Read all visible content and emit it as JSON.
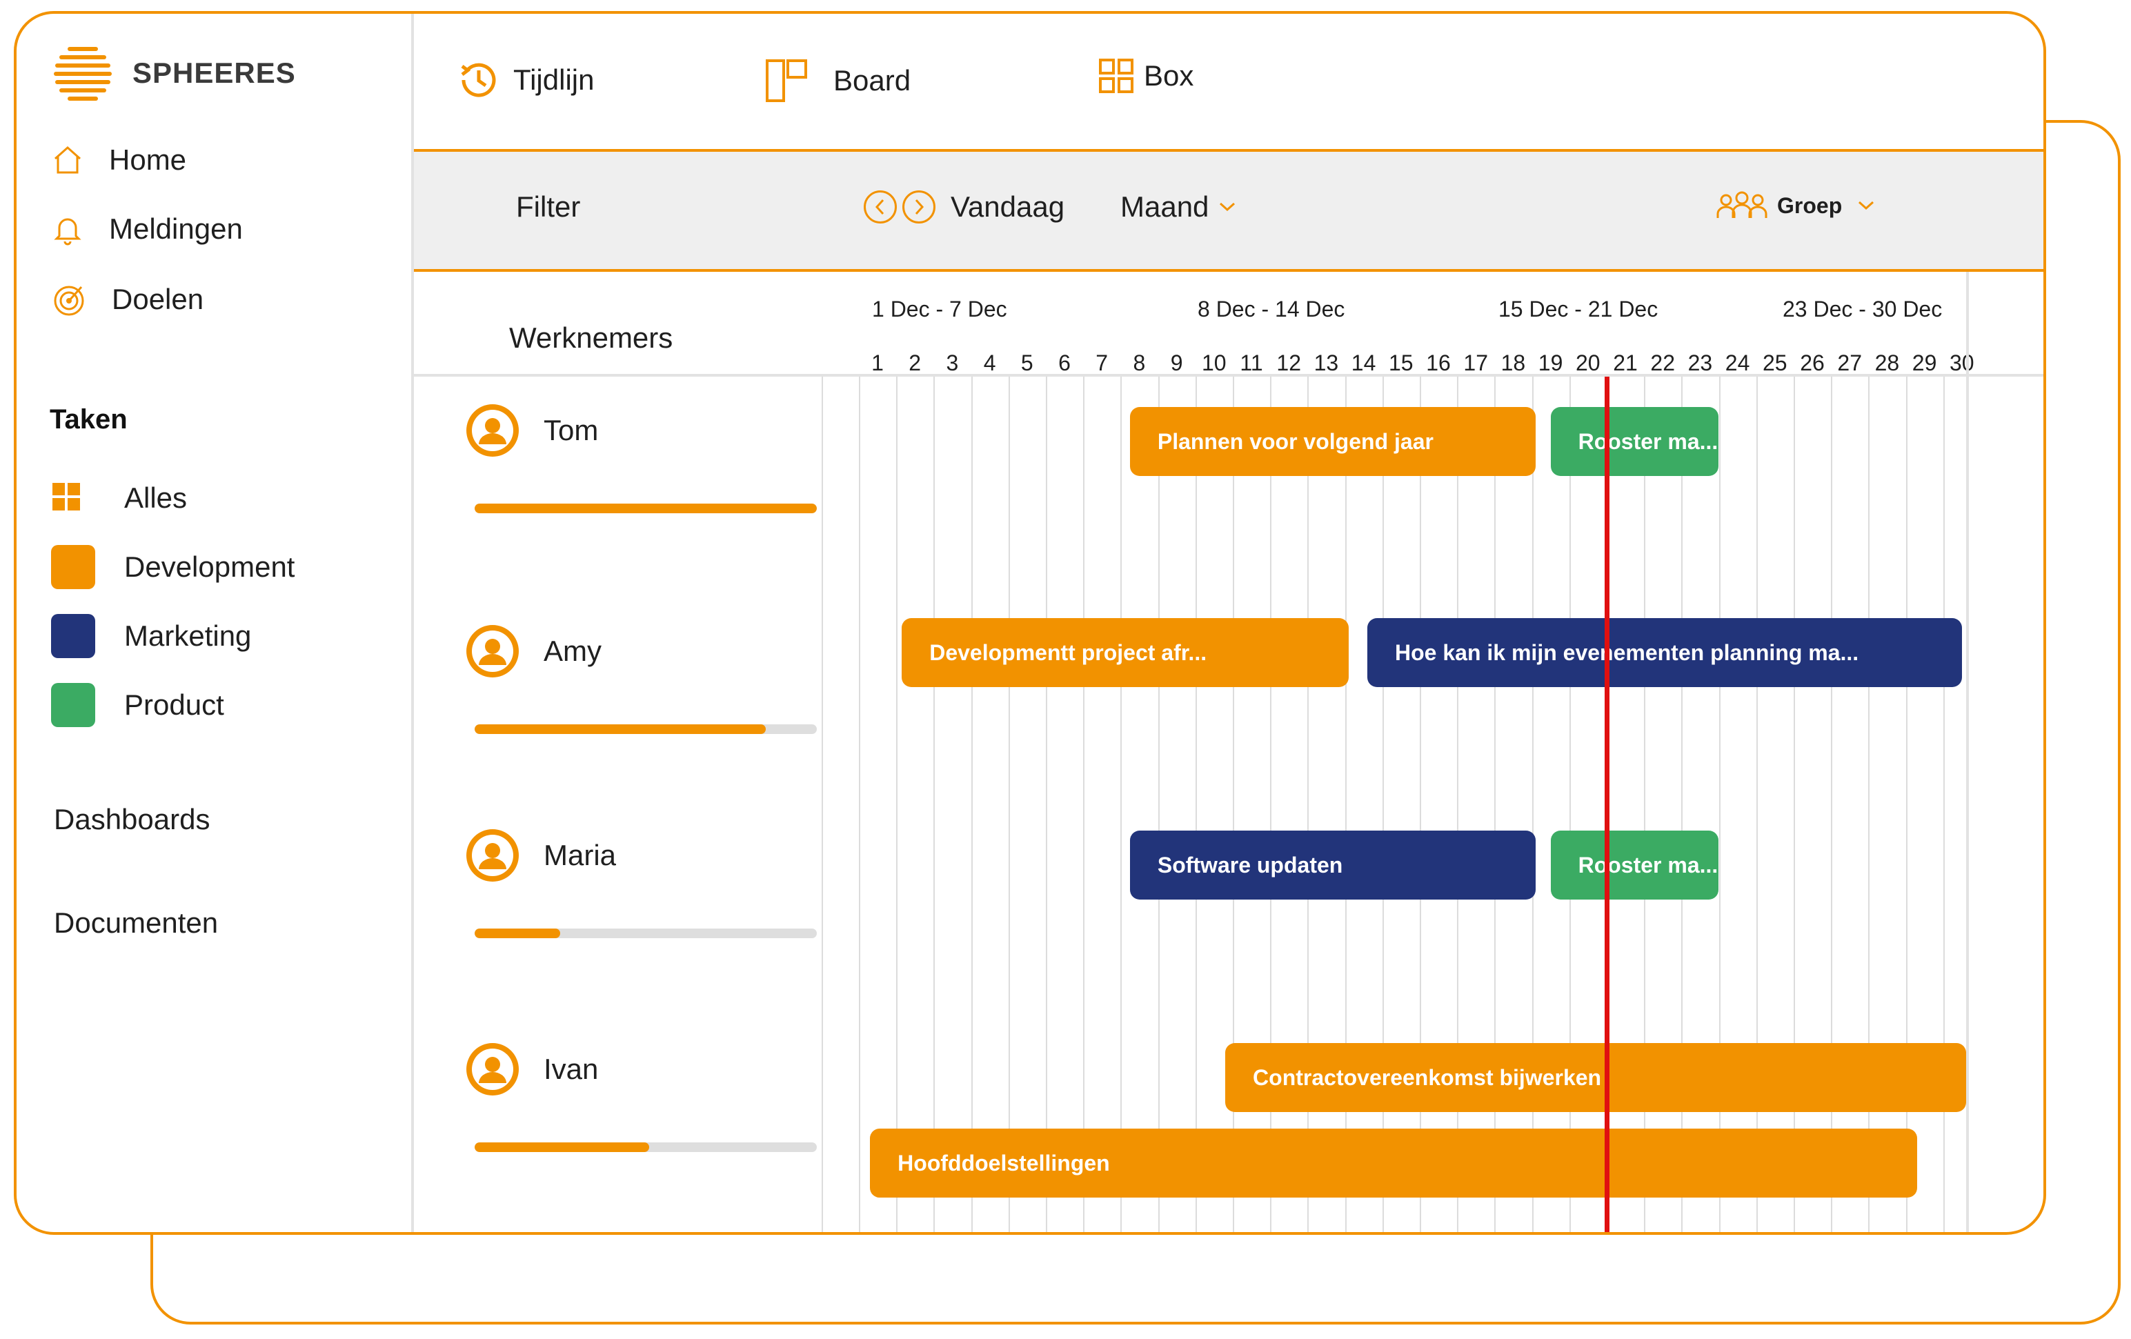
{
  "brand": {
    "name": "SPHEERES"
  },
  "colors": {
    "accent": "#f29200",
    "development": "#f29200",
    "marketing": "#22347a",
    "product": "#3bab63",
    "today_line": "#e01010"
  },
  "nav": [
    {
      "label": "Home",
      "icon": "home-icon"
    },
    {
      "label": "Meldingen",
      "icon": "bell-icon"
    },
    {
      "label": "Doelen",
      "icon": "target-icon"
    }
  ],
  "tasks": {
    "title": "Taken",
    "items": [
      {
        "label": "Alles",
        "icon": "grid-icon"
      },
      {
        "label": "Development",
        "color": "#f29200"
      },
      {
        "label": "Marketing",
        "color": "#22347a"
      },
      {
        "label": "Product",
        "color": "#3bab63"
      }
    ]
  },
  "links": {
    "dashboards": "Dashboards",
    "documents": "Documenten"
  },
  "views": [
    {
      "label": "Tijdlijn",
      "icon": "clock-history-icon"
    },
    {
      "label": "Board",
      "icon": "board-icon"
    },
    {
      "label": "Box",
      "icon": "box-grid-icon"
    }
  ],
  "filterbar": {
    "filter": "Filter",
    "today": "Vandaag",
    "period": "Maand",
    "group": "Groep"
  },
  "grid": {
    "employees_header": "Werknemers",
    "weeks": [
      "1 Dec - 7 Dec",
      "8 Dec - 14 Dec",
      "15 Dec - 21 Dec",
      "23 Dec - 30 Dec"
    ],
    "days": [
      "1",
      "2",
      "3",
      "4",
      "5",
      "6",
      "7",
      "8",
      "9",
      "10",
      "11",
      "12",
      "13",
      "14",
      "15",
      "16",
      "17",
      "18",
      "19",
      "20",
      "21",
      "22",
      "23",
      "24",
      "25",
      "26",
      "27",
      "28",
      "29",
      "30"
    ],
    "today": 20.5
  },
  "employees": [
    {
      "name": "Tom",
      "progress": 1.0
    },
    {
      "name": "Amy",
      "progress": 0.85
    },
    {
      "name": "Maria",
      "progress": 0.25
    },
    {
      "name": "Ivan",
      "progress": 0.51
    }
  ],
  "bars": [
    {
      "label": "Plannen voor volgend jaar",
      "category": "development",
      "row": 0,
      "start": 7.75,
      "end": 18.6
    },
    {
      "label": "Rooster ma...",
      "category": "product",
      "row": 0,
      "start": 19.0,
      "end": 23.5
    },
    {
      "label": "Developmentt project afr...",
      "category": "development",
      "row": 1,
      "start": 1.65,
      "end": 13.6
    },
    {
      "label": "Hoe kan ik mijn evenementen planning ma...",
      "category": "marketing",
      "row": 1,
      "start": 14.1,
      "end": 30.0
    },
    {
      "label": "Software updaten",
      "category": "marketing",
      "row": 2,
      "start": 7.75,
      "end": 18.6
    },
    {
      "label": "Rooster ma...",
      "category": "product",
      "row": 2,
      "start": 19.0,
      "end": 23.5
    },
    {
      "label": "Contractovereenkomst bijwerken",
      "category": "development",
      "row": 3,
      "start": 10.3,
      "end": 31.0
    },
    {
      "label": "Hoofddoelstellingen",
      "category": "development",
      "row": 4,
      "start": 0.8,
      "end": 28.8
    }
  ]
}
